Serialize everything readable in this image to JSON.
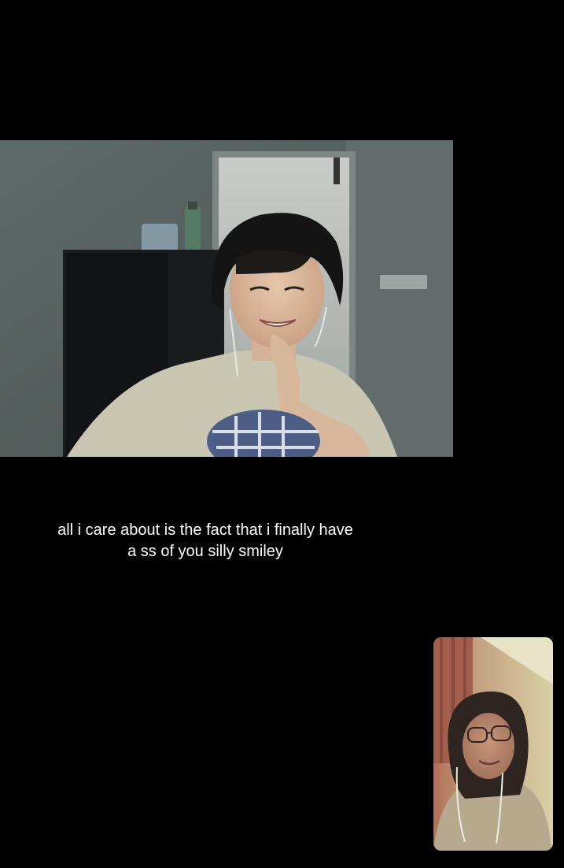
{
  "call": {
    "remote_participant": "remote-video-feed",
    "self_view": "self-preview"
  },
  "caption": {
    "lines": [
      "all i care about is the fact that i finally have",
      "a ss of you silly smiley"
    ]
  },
  "colors": {
    "background": "#000000",
    "caption_text": "#ffffff"
  }
}
